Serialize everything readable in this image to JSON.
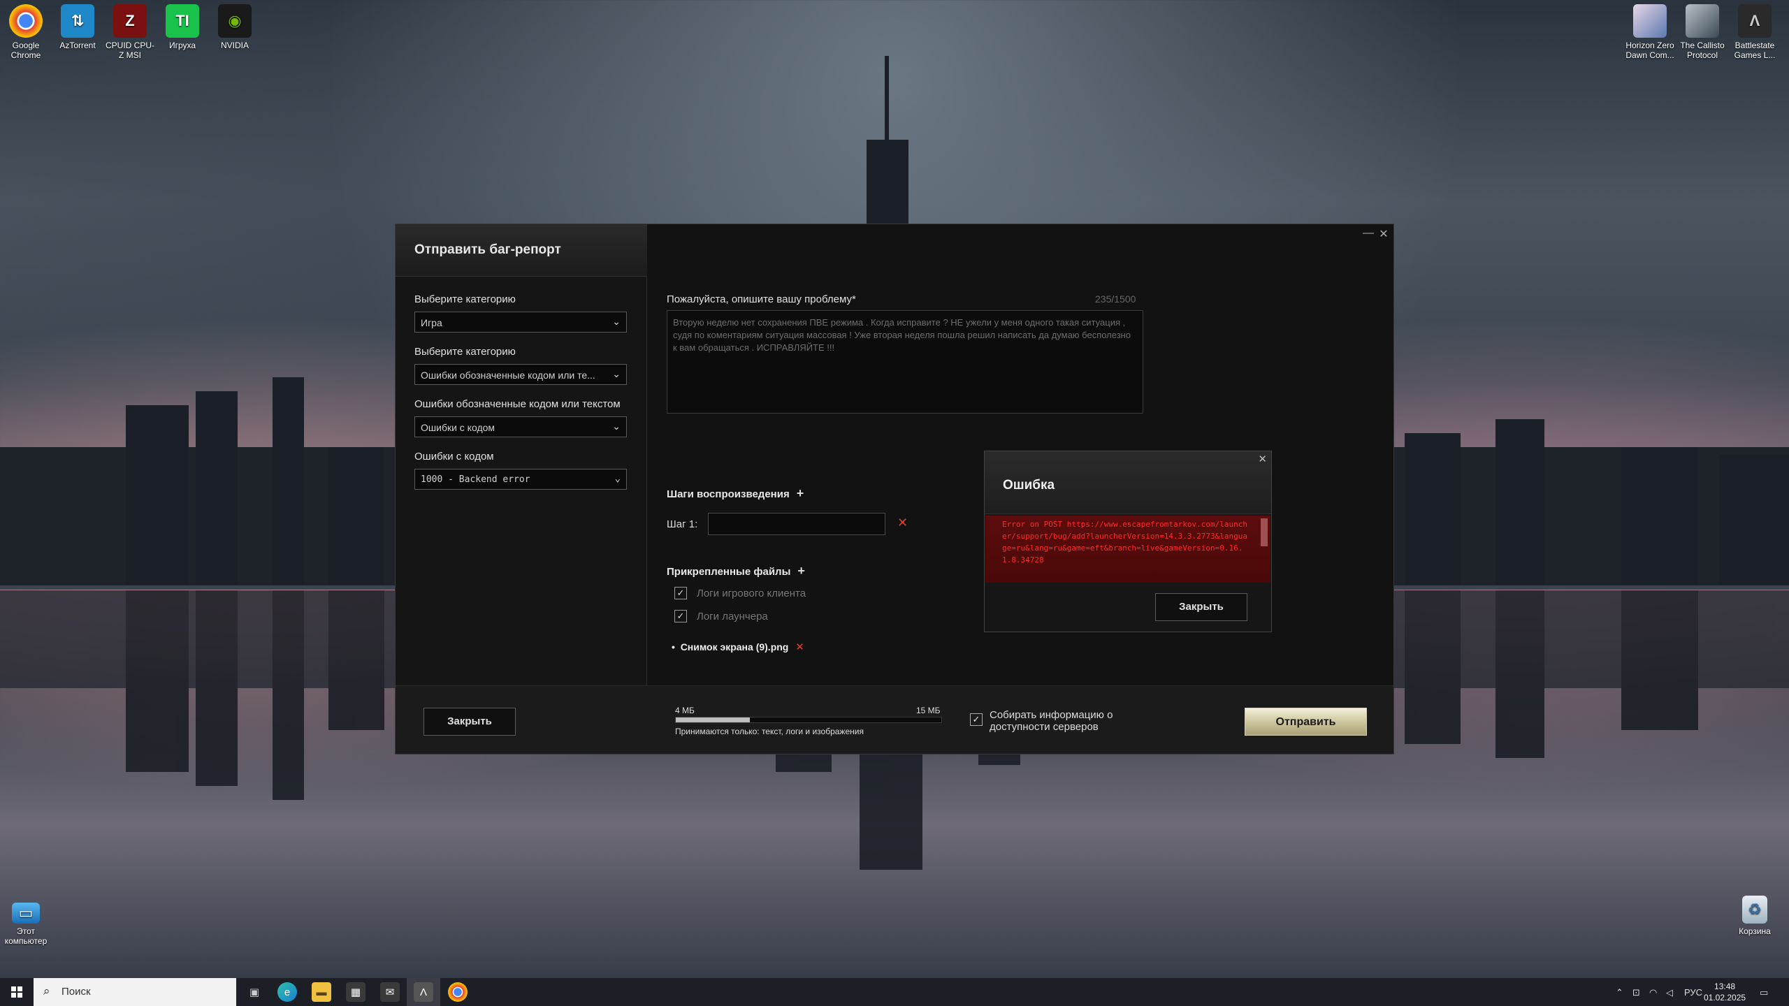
{
  "desktop": {
    "icons_left": [
      {
        "label": "Google Chrome",
        "icon": "chrome-icon",
        "color": "#e34133"
      },
      {
        "label": "AzTorrent",
        "icon": "aztorrent-icon",
        "color": "#1e88c8"
      },
      {
        "label": "CPUID CPU-Z MSI",
        "icon": "cpuz-icon",
        "color": "#b01818"
      },
      {
        "label": "Игруха",
        "icon": "igruha-icon",
        "color": "#19c24a"
      },
      {
        "label": "NVIDIA",
        "icon": "nvidia-icon",
        "color": "#76b900"
      }
    ],
    "icons_right": [
      {
        "label": "Horizon Zero Dawn Com...",
        "icon": "horizon-icon"
      },
      {
        "label": "The Callisto Protocol",
        "icon": "callisto-icon"
      },
      {
        "label": "Battlestate Games L...",
        "icon": "battlestate-icon"
      }
    ],
    "this_pc": "Этот компьютер",
    "recycle_bin": "Корзина"
  },
  "window": {
    "title": "Отправить баг-репорт",
    "minimize": "—",
    "close": "✕",
    "fields": [
      {
        "label": "Выберите категорию",
        "value": "Игра"
      },
      {
        "label": "Выберите категорию",
        "value": "Ошибки обозначенные кодом или те..."
      },
      {
        "label": "Ошибки обозначенные кодом или текстом",
        "value": "Ошибки с кодом"
      },
      {
        "label": "Ошибки с кодом",
        "value": "1000 - Backend error"
      }
    ],
    "problem_label": "Пожалуйста, опишите вашу проблему*",
    "counter": "235/1500",
    "problem_text": "Вторую неделю нет сохранения ПВЕ режима . Когда исправите ? НЕ ужели у меня одного такая ситуация , судя по коментариям ситуация массовая ! Уже вторая неделя пошла решил написать да думаю бесполезно к вам обращаться . ИСПРАВЛЯЙТЕ !!!",
    "steps_label": "Шаги воспроизведения",
    "step1_label": "Шаг 1:",
    "attached_label": "Прикрепленные файлы",
    "attachments": [
      "Логи игрового клиента",
      "Логи лаунчера"
    ],
    "file_name": "Снимок экрана (9).png",
    "close_btn": "Закрыть",
    "size_min": "4 МБ",
    "size_max": "15 МБ",
    "size_fill_fraction": 0.28,
    "accept_text": "Принимаются только: текст, логи и изображения",
    "collect_label": "Собирать информацию о доступности серверов",
    "send_btn": "Отправить"
  },
  "error_dialog": {
    "title": "Ошибка",
    "close": "✕",
    "message": "Error on POST https://www.escapefromtarkov.com/launcher/support/bug/add?launcherVersion=14.3.3.2773&language=ru&lang=ru&game=eft&branch=live&gameVersion=0.16.1.8.34728",
    "button": "Закрыть"
  },
  "taskbar": {
    "search_placeholder": "Поиск",
    "lang": "РУС",
    "time": "13:48",
    "date": "01.02.2025"
  }
}
